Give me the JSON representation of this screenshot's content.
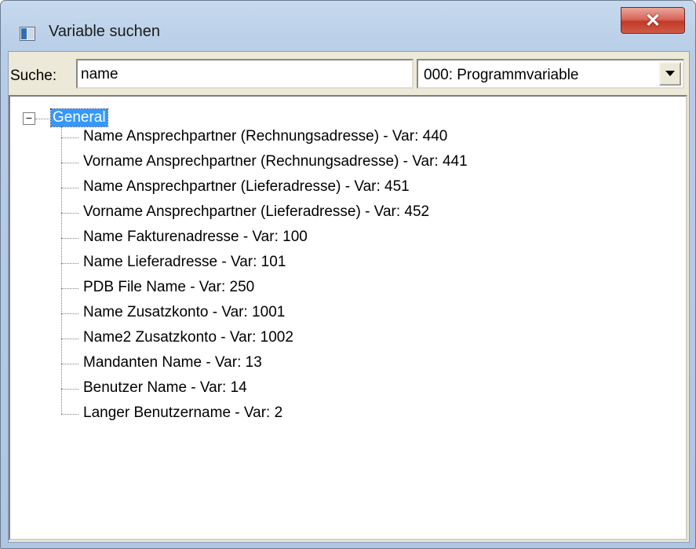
{
  "window": {
    "title": "Variable suchen"
  },
  "search": {
    "label": "Suche:",
    "value": "name"
  },
  "category": {
    "selected": "000: Programmvariable"
  },
  "tree": {
    "root": "General",
    "items": [
      "Name Ansprechpartner (Rechnungsadresse) - Var: 440",
      "Vorname Ansprechpartner (Rechnungsadresse) - Var: 441",
      "Name Ansprechpartner (Lieferadresse) - Var: 451",
      "Vorname Ansprechpartner (Lieferadresse) - Var: 452",
      "Name Fakturenadresse - Var: 100",
      "Name Lieferadresse - Var: 101",
      "PDB File Name - Var: 250",
      "Name Zusatzkonto - Var: 1001",
      "Name2 Zusatzkonto - Var: 1002",
      "Mandanten Name - Var: 13",
      "Benutzer Name - Var: 14",
      "Langer Benutzername - Var: 2"
    ]
  },
  "icons": {
    "app": "window-icon",
    "close": "close-icon",
    "dropdown": "chevron-down-icon",
    "expander": "minus-icon"
  },
  "colors": {
    "selection": "#3399ff",
    "close_button": "#c23a28"
  }
}
